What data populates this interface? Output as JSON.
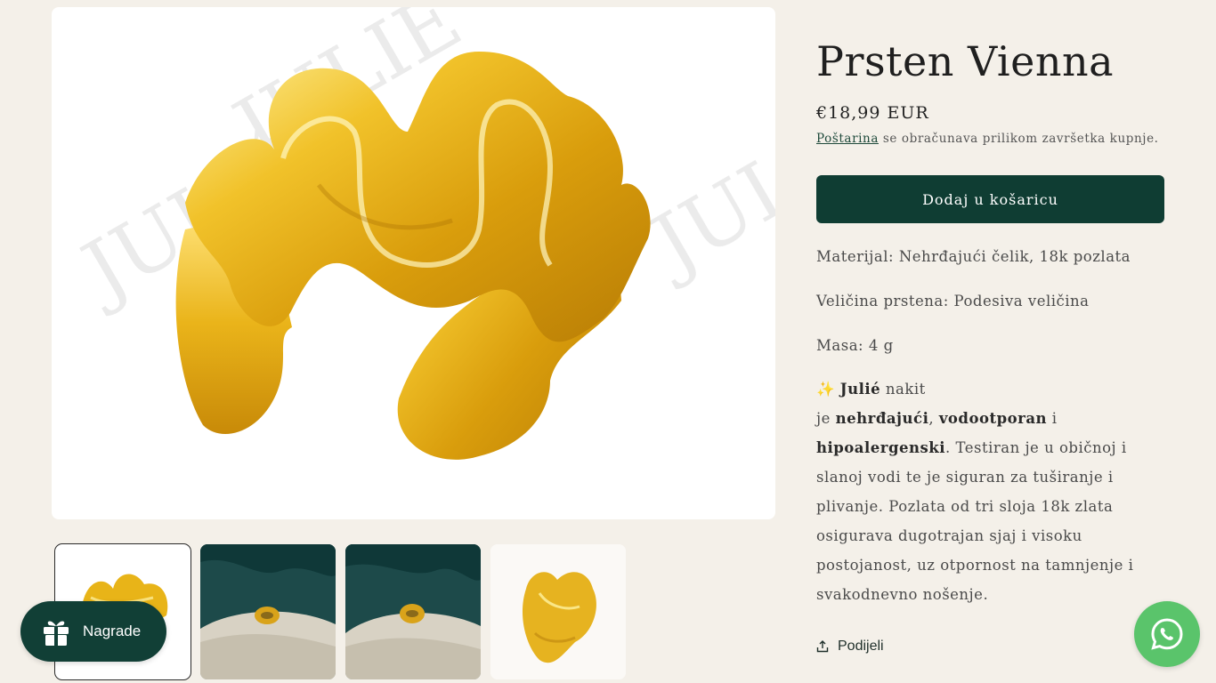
{
  "product": {
    "title": "Prsten Vienna",
    "price": "€18,99 EUR",
    "shipping_link": "Poštarina",
    "shipping_text": " se obračunava prilikom završetka kupnje.",
    "add_to_cart": "Dodaj u košaricu"
  },
  "description": {
    "material": "Materijal: Nehrđajući čelik, 18k pozlata",
    "size": "Veličina prstena: Podesiva veličina",
    "weight": "Masa: 4 g",
    "sparkle": "✨",
    "brand": "Julié",
    "brand_suffix": " nakit",
    "line_je": "je ",
    "prop1": "nehrđajući",
    "comma": ", ",
    "prop2": "vodootporan",
    "and": " i ",
    "prop3": "hipoalergenski",
    "period": ".",
    "body": "Testiran je u običnoj i slanoj vodi te je siguran za tuširanje i plivanje. Pozlata od tri sloja 18k zlata osigurava dugotrajan sjaj i visoku postojanost, uz otpornost na tamnjenje i svakodnevno nošenje."
  },
  "share": {
    "label": "Podijeli",
    "icon": "share-icon"
  },
  "rewards": {
    "label": "Nagrade",
    "icon": "gift-icon"
  },
  "whatsapp": {
    "icon": "whatsapp-icon"
  },
  "watermark": "JULIÉ",
  "colors": {
    "background": "#f4f0e9",
    "button": "#0f3d33",
    "gold": "#e8b418",
    "whatsapp": "#5ac46b"
  }
}
